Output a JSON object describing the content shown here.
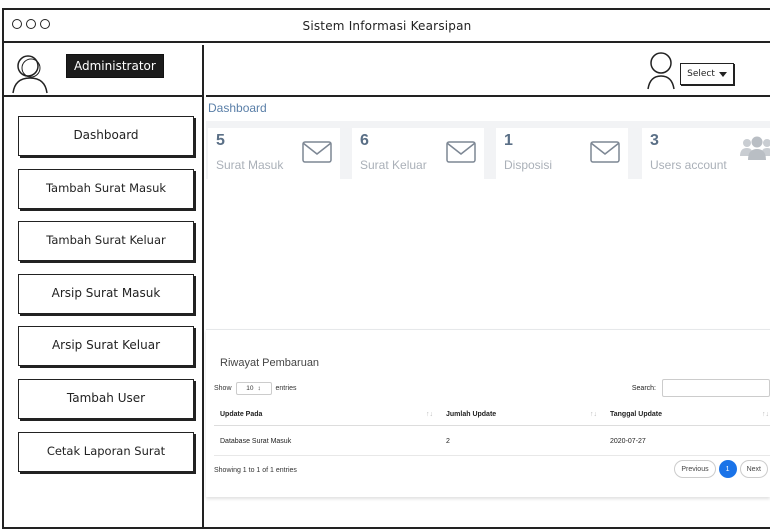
{
  "window": {
    "title": "Sistem Informasi Kearsipan"
  },
  "sidebar": {
    "role_label": "Administrator",
    "items": [
      {
        "label": "Dashboard"
      },
      {
        "label": "Tambah Surat Masuk"
      },
      {
        "label": "Tambah Surat Keluar"
      },
      {
        "label": "Arsip Surat Masuk"
      },
      {
        "label": "Arsip Surat Keluar"
      },
      {
        "label": "Tambah User"
      },
      {
        "label": "Cetak Laporan Surat"
      }
    ]
  },
  "topbar": {
    "select_label": "Select"
  },
  "main": {
    "title": "Dashboard",
    "cards": [
      {
        "count": "5",
        "label": "Surat Masuk",
        "icon": "envelope-icon"
      },
      {
        "count": "6",
        "label": "Surat Keluar",
        "icon": "envelope-icon"
      },
      {
        "count": "1",
        "label": "Disposisi",
        "icon": "envelope-icon"
      },
      {
        "count": "3",
        "label": "Users account",
        "icon": "users-icon"
      }
    ],
    "history": {
      "title": "Riwayat Pembaruan",
      "show_label": "Show",
      "entries_value": "10",
      "entries_label": "entries",
      "search_label": "Search:",
      "columns": [
        "Update Pada",
        "Jumlah Update",
        "Tanggal Update"
      ],
      "rows": [
        [
          "Database Surat Masuk",
          "2",
          "2020-07-27"
        ]
      ],
      "info": "Showing 1 to 1 of 1 entries",
      "pagination": {
        "previous": "Previous",
        "current": "1",
        "next": "Next"
      }
    }
  },
  "colors": {
    "accent": "#1a73e8",
    "title_blue": "#5a7fa8",
    "card_bg": "#f2f3f5"
  }
}
